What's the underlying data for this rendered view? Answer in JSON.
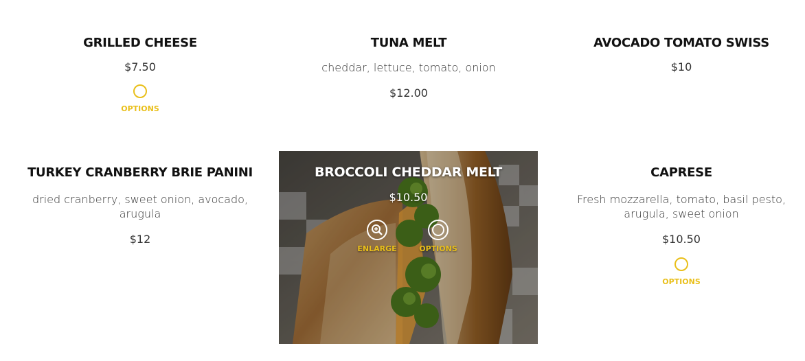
{
  "colors": {
    "accent": "#e9bf1a",
    "heading": "#111111",
    "text": "#333333"
  },
  "items": [
    {
      "name": "GRILLED CHEESE",
      "price": "$7.50",
      "options_label": "OPTIONS"
    },
    {
      "name": "TUNA MELT",
      "description": "cheddar, lettuce, tomato, onion",
      "price": "$12.00"
    },
    {
      "name": "AVOCADO TOMATO SWISS",
      "price": "$10"
    },
    {
      "name": "TURKEY CRANBERRY BRIE PANINI",
      "description_line1": "dried cranberry, sweet onion, avocado,",
      "description_line2": "arugula",
      "price": "$12"
    },
    {
      "name": "BROCCOLI CHEDDAR MELT",
      "price": "$10.50",
      "enlarge_label": "ENLARGE",
      "options_label": "OPTIONS",
      "icons": [
        "zoom-in-icon",
        "options-ring-icon"
      ]
    },
    {
      "name": "CAPRESE",
      "description_line1": "Fresh mozzarella, tomato, basil pesto,",
      "description_line2": "arugula, sweet onion",
      "price": "$10.50",
      "options_label": "OPTIONS"
    }
  ]
}
